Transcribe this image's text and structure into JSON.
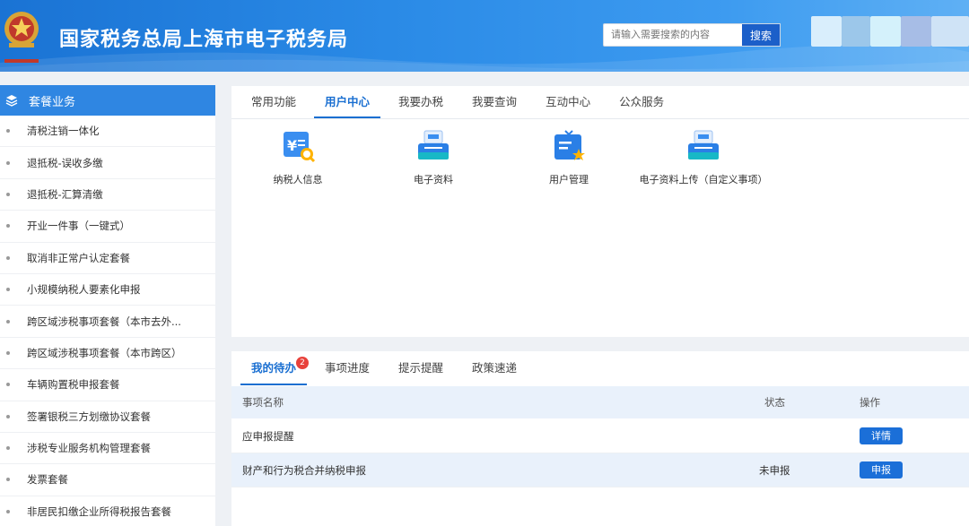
{
  "header": {
    "title": "国家税务总局上海市电子税务局",
    "search_placeholder": "请输入需要搜索的内容",
    "search_button": "搜索"
  },
  "sidebar": {
    "title": "套餐业务",
    "items": [
      {
        "label": "清税注销一体化"
      },
      {
        "label": "退抵税-误收多缴"
      },
      {
        "label": "退抵税-汇算清缴"
      },
      {
        "label": "开业一件事（一键式）"
      },
      {
        "label": "取消非正常户认定套餐"
      },
      {
        "label": "小规模纳税人要素化申报"
      },
      {
        "label": "跨区域涉税事项套餐（本市去外..."
      },
      {
        "label": "跨区域涉税事项套餐（本市跨区）"
      },
      {
        "label": "车辆购置税申报套餐"
      },
      {
        "label": "签署银税三方划缴协议套餐"
      },
      {
        "label": "涉税专业服务机构管理套餐"
      },
      {
        "label": "发票套餐"
      },
      {
        "label": "非居民扣缴企业所得税报告套餐"
      }
    ]
  },
  "main_tabs": [
    {
      "label": "常用功能"
    },
    {
      "label": "用户中心"
    },
    {
      "label": "我要办税"
    },
    {
      "label": "我要查询"
    },
    {
      "label": "互动中心"
    },
    {
      "label": "公众服务"
    }
  ],
  "functions": [
    {
      "label": "纳税人信息",
      "icon": "taxpayer-info-icon"
    },
    {
      "label": "电子资料",
      "icon": "electronic-data-icon"
    },
    {
      "label": "用户管理",
      "icon": "user-management-icon"
    },
    {
      "label": "电子资料上传（自定义事项）",
      "icon": "electronic-data-upload-icon"
    }
  ],
  "todo": {
    "tabs": [
      {
        "label": "我的待办",
        "badge": "2"
      },
      {
        "label": "事项进度"
      },
      {
        "label": "提示提醒"
      },
      {
        "label": "政策速递"
      }
    ],
    "columns": {
      "name": "事项名称",
      "status": "状态",
      "action": "操作"
    },
    "rows": [
      {
        "name": "应申报提醒",
        "status": "",
        "action": "详情"
      },
      {
        "name": "财产和行为税合并纳税申报",
        "status": "未申报",
        "action": "申报"
      }
    ]
  },
  "colors": {
    "header_blue": "#2a8ae6",
    "accent": "#1a6fd1",
    "badge_red": "#e8413b",
    "sidebar_head": "#2f86e2"
  }
}
